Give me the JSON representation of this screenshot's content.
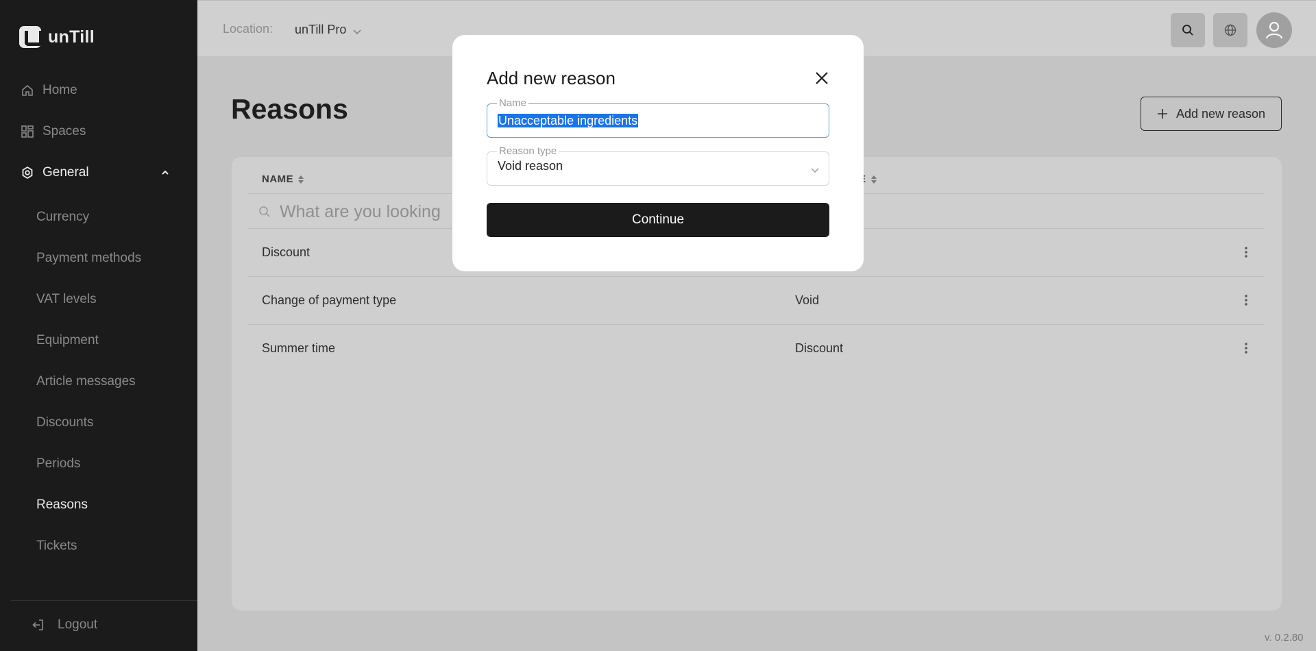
{
  "app": {
    "brand": "unTill",
    "version": "v. 0.2.80"
  },
  "sidebar": {
    "items": [
      {
        "label": "Home",
        "icon": "home-icon"
      },
      {
        "label": "Spaces",
        "icon": "grid-icon"
      },
      {
        "label": "General",
        "icon": "settings-icon",
        "expanded": true
      }
    ],
    "sub_items": [
      {
        "label": "Currency"
      },
      {
        "label": "Payment methods"
      },
      {
        "label": "VAT levels"
      },
      {
        "label": "Equipment"
      },
      {
        "label": "Article messages"
      },
      {
        "label": "Discounts"
      },
      {
        "label": "Periods"
      },
      {
        "label": "Reasons",
        "active": true
      },
      {
        "label": "Tickets"
      }
    ],
    "logout_label": "Logout"
  },
  "topbar": {
    "location_label": "Location:",
    "location_value": "unTill Pro"
  },
  "main": {
    "title": "Reasons",
    "add_button_label": "Add new reason",
    "columns": [
      "NAME",
      "E"
    ],
    "search_placeholder": "What are you looking",
    "rows": [
      {
        "name": "Discount",
        "type": ""
      },
      {
        "name": "Change of payment type",
        "type": "Void"
      },
      {
        "name": "Summer time",
        "type": "Discount"
      }
    ]
  },
  "modal": {
    "title": "Add new reason",
    "name_label": "Name",
    "name_value": "Unacceptable ingredients",
    "type_label": "Reason type",
    "type_value": "Void reason",
    "continue_label": "Continue"
  },
  "colors": {
    "sidebar_bg": "#1b1b1b",
    "overlay_bg": "#c4c4c4",
    "focus_border": "#4fa3e6",
    "selection": "#1a74e8",
    "primary_button": "#1b1b1b"
  }
}
